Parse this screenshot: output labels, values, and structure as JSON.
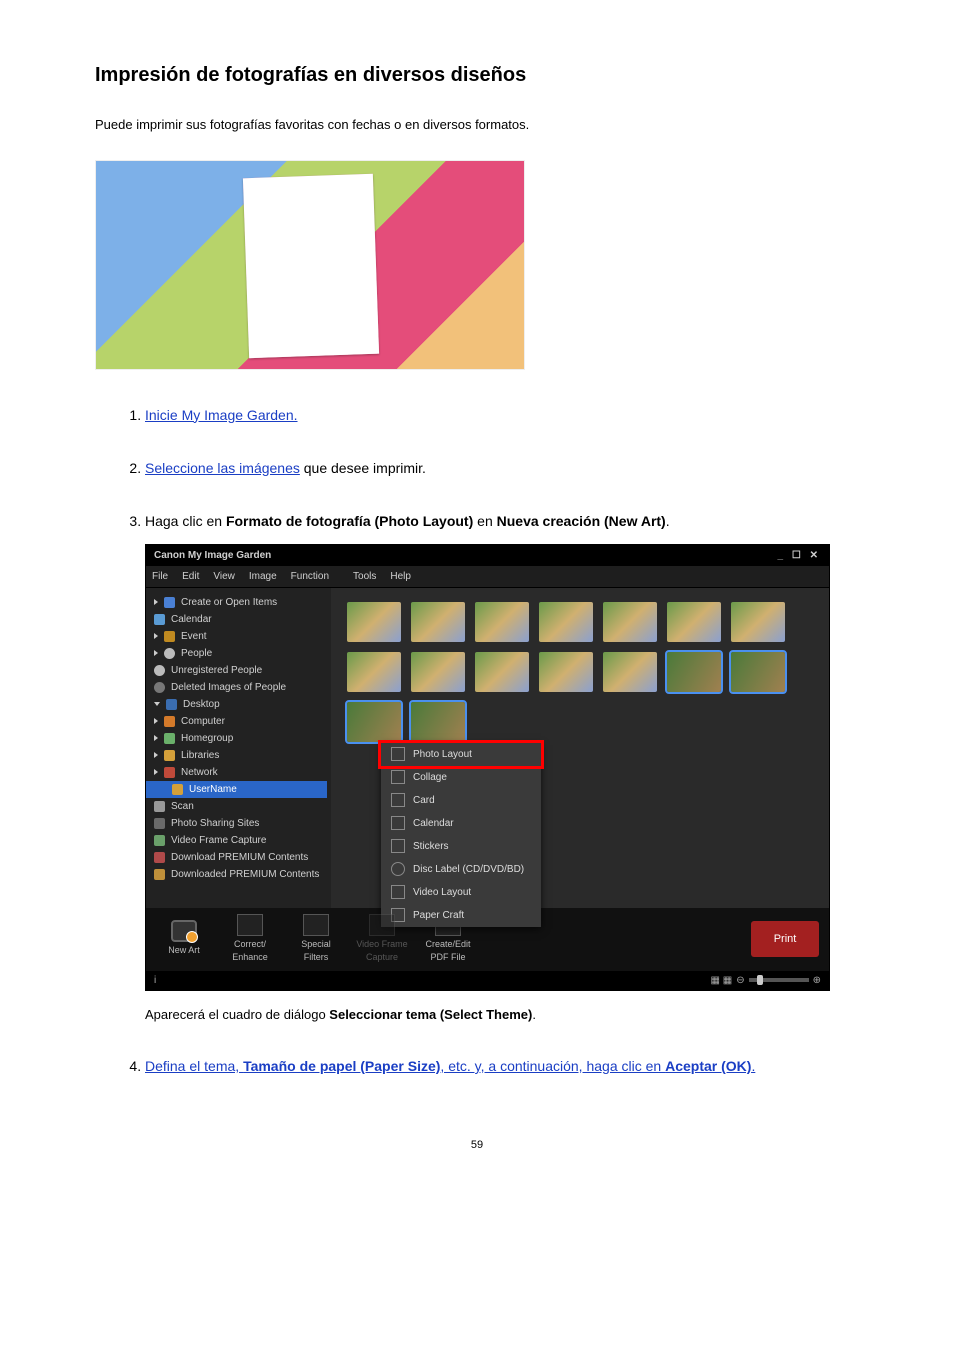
{
  "title": "Impresión de fotografías en diversos diseños",
  "intro": "Puede imprimir sus fotografías favoritas con fechas o en diversos formatos.",
  "steps": {
    "s1_link": "Inicie My Image Garden.",
    "s2_link": "Seleccione las imágenes",
    "s2_tail": " que desee imprimir.",
    "s3_pre": "Haga clic en ",
    "s3_b1": "Formato de fotografía (Photo Layout)",
    "s3_mid": " en ",
    "s3_b2": "Nueva creación (New Art)",
    "s3_end": ".",
    "s3_caption_pre": "Aparecerá el cuadro de diálogo ",
    "s3_caption_b": "Seleccionar tema (Select Theme)",
    "s3_caption_end": ".",
    "s4_pre": "Defina el tema, ",
    "s4_b": "Tamaño de papel (Paper Size)",
    "s4_mid": ", etc. y, a continuación, haga clic en ",
    "s4_b2": "Aceptar (OK)",
    "s4_end": "."
  },
  "app": {
    "title": "Canon My Image Garden",
    "winctl": "_ ☐ ✕",
    "menu": [
      "File",
      "Edit",
      "View",
      "Image",
      "Function",
      "Tools",
      "Help"
    ],
    "side": {
      "create": "Create or Open Items",
      "calendar": "Calendar",
      "event": "Event",
      "people": "People",
      "unreg": "Unregistered People",
      "delimg": "Deleted Images of People",
      "desktop": "Desktop",
      "computer": "Computer",
      "homegroup": "Homegroup",
      "libraries": "Libraries",
      "network": "Network",
      "username": "UserName",
      "scan": "Scan",
      "share": "Photo Sharing Sites",
      "vframe": "Video Frame Capture",
      "dlprem": "Download PREMIUM Contents",
      "dledprem": "Downloaded PREMIUM Contents"
    },
    "popup": {
      "photo": "Photo Layout",
      "collage": "Collage",
      "card": "Card",
      "calendar": "Calendar",
      "stickers": "Stickers",
      "disc": "Disc Label (CD/DVD/BD)",
      "video": "Video Layout",
      "paper": "Paper Craft"
    },
    "bottom": {
      "newart": "New Art",
      "correct": "Correct/\nEnhance",
      "special": "Special\nFilters",
      "vcap": "Video Frame\nCapture",
      "pdf": "Create/Edit\nPDF File",
      "print": "Print"
    },
    "status_i": "i"
  },
  "pagenum": "59"
}
